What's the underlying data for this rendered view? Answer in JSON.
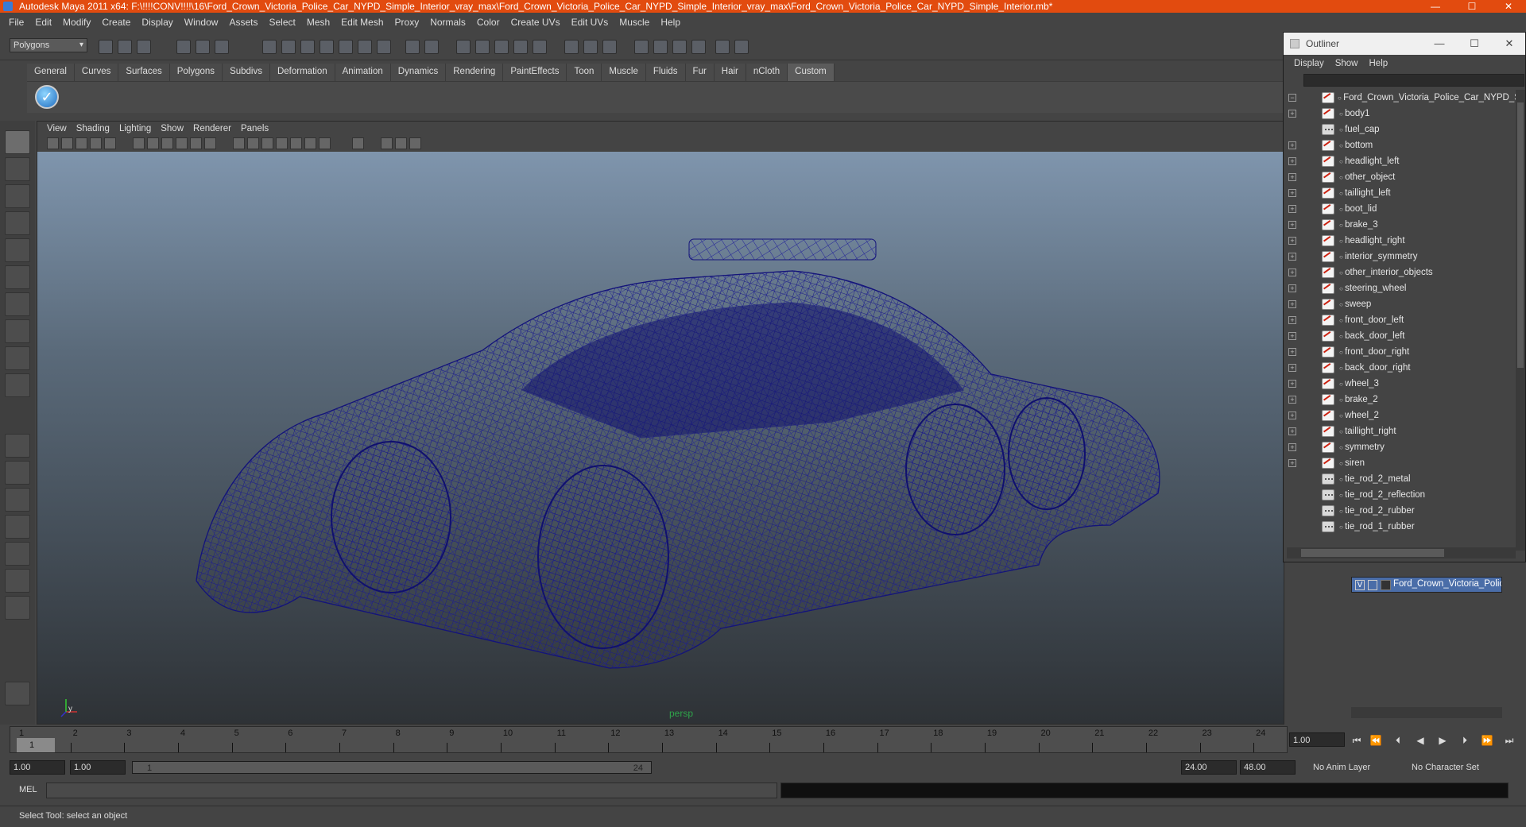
{
  "window": {
    "title": "Autodesk Maya 2011 x64: F:\\!!!!CONV!!!!\\16\\Ford_Crown_Victoria_Police_Car_NYPD_Simple_Interior_vray_max\\Ford_Crown_Victoria_Police_Car_NYPD_Simple_Interior_vray_max\\Ford_Crown_Victoria_Police_Car_NYPD_Simple_Interior.mb*",
    "minimize": "—",
    "maximize": "☐",
    "close": "✕"
  },
  "menubar": [
    "File",
    "Edit",
    "Modify",
    "Create",
    "Display",
    "Window",
    "Assets",
    "Select",
    "Mesh",
    "Edit Mesh",
    "Proxy",
    "Normals",
    "Color",
    "Create UVs",
    "Edit UVs",
    "Muscle",
    "Help"
  ],
  "statusline": {
    "mode": "Polygons"
  },
  "shelf": {
    "tabs": [
      "General",
      "Curves",
      "Surfaces",
      "Polygons",
      "Subdivs",
      "Deformation",
      "Animation",
      "Dynamics",
      "Rendering",
      "PaintEffects",
      "Toon",
      "Muscle",
      "Fluids",
      "Fur",
      "Hair",
      "nCloth",
      "Custom"
    ],
    "active_tab": "Custom",
    "icon": "checkmark-icon"
  },
  "viewport": {
    "menu": [
      "View",
      "Shading",
      "Lighting",
      "Show",
      "Renderer",
      "Panels"
    ],
    "camera_label": "persp",
    "wire_color": "#1a1a80",
    "axis": {
      "x": "x",
      "y": "y"
    }
  },
  "outliner": {
    "title": "Outliner",
    "menu": [
      "Display",
      "Show",
      "Help"
    ],
    "root": "Ford_Crown_Victoria_Police_Car_NYPD_Simp",
    "items": [
      {
        "label": "body1",
        "type": "mesh",
        "expand": true
      },
      {
        "label": "fuel_cap",
        "type": "group",
        "expand": false
      },
      {
        "label": "bottom",
        "type": "mesh",
        "expand": true
      },
      {
        "label": "headlight_left",
        "type": "mesh",
        "expand": true
      },
      {
        "label": "other_object",
        "type": "mesh",
        "expand": true
      },
      {
        "label": "taillight_left",
        "type": "mesh",
        "expand": true
      },
      {
        "label": "boot_lid",
        "type": "mesh",
        "expand": true
      },
      {
        "label": "brake_3",
        "type": "mesh",
        "expand": true
      },
      {
        "label": "headlight_right",
        "type": "mesh",
        "expand": true
      },
      {
        "label": "interior_symmetry",
        "type": "mesh",
        "expand": true
      },
      {
        "label": "other_interior_objects",
        "type": "mesh",
        "expand": true
      },
      {
        "label": "steering_wheel",
        "type": "mesh",
        "expand": true
      },
      {
        "label": "sweep",
        "type": "mesh",
        "expand": true
      },
      {
        "label": "front_door_left",
        "type": "mesh",
        "expand": true
      },
      {
        "label": "back_door_left",
        "type": "mesh",
        "expand": true
      },
      {
        "label": "front_door_right",
        "type": "mesh",
        "expand": true
      },
      {
        "label": "back_door_right",
        "type": "mesh",
        "expand": true
      },
      {
        "label": "wheel_3",
        "type": "mesh",
        "expand": true
      },
      {
        "label": "brake_2",
        "type": "mesh",
        "expand": true
      },
      {
        "label": "wheel_2",
        "type": "mesh",
        "expand": true
      },
      {
        "label": "taillight_right",
        "type": "mesh",
        "expand": true
      },
      {
        "label": "symmetry",
        "type": "mesh",
        "expand": true
      },
      {
        "label": "siren",
        "type": "mesh",
        "expand": true
      },
      {
        "label": "tie_rod_2_metal",
        "type": "group",
        "expand": false
      },
      {
        "label": "tie_rod_2_reflection",
        "type": "group",
        "expand": false
      },
      {
        "label": "tie_rod_2_rubber",
        "type": "group",
        "expand": false
      },
      {
        "label": "tie_rod_1_rubber",
        "type": "group",
        "expand": false
      }
    ]
  },
  "layers": {
    "row": {
      "visible": "V",
      "name": "Ford_Crown_Victoria_Police_"
    }
  },
  "timeline": {
    "ticks": [
      "1",
      "2",
      "3",
      "4",
      "5",
      "6",
      "7",
      "8",
      "9",
      "10",
      "11",
      "12",
      "13",
      "14",
      "15",
      "16",
      "17",
      "18",
      "19",
      "20",
      "21",
      "22",
      "23",
      "24"
    ],
    "current_frame": "1.00",
    "marker": "1"
  },
  "range": {
    "start": "1.00",
    "anim_start": "1.00",
    "slider_start": "1",
    "slider_end": "24",
    "anim_end": "24.00",
    "end": "48.00",
    "anim_layer": "No Anim Layer",
    "char_set": "No Character Set"
  },
  "command": {
    "label": "MEL"
  },
  "help": {
    "text": "Select Tool: select an object"
  }
}
